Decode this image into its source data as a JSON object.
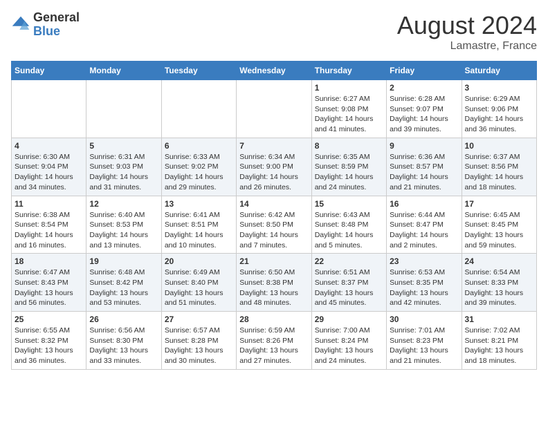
{
  "header": {
    "logo": {
      "general": "General",
      "blue": "Blue"
    },
    "month": "August 2024",
    "location": "Lamastre, France"
  },
  "weekdays": [
    "Sunday",
    "Monday",
    "Tuesday",
    "Wednesday",
    "Thursday",
    "Friday",
    "Saturday"
  ],
  "weeks": [
    [
      {
        "day": "",
        "info": ""
      },
      {
        "day": "",
        "info": ""
      },
      {
        "day": "",
        "info": ""
      },
      {
        "day": "",
        "info": ""
      },
      {
        "day": "1",
        "info": "Sunrise: 6:27 AM\nSunset: 9:08 PM\nDaylight: 14 hours\nand 41 minutes."
      },
      {
        "day": "2",
        "info": "Sunrise: 6:28 AM\nSunset: 9:07 PM\nDaylight: 14 hours\nand 39 minutes."
      },
      {
        "day": "3",
        "info": "Sunrise: 6:29 AM\nSunset: 9:06 PM\nDaylight: 14 hours\nand 36 minutes."
      }
    ],
    [
      {
        "day": "4",
        "info": "Sunrise: 6:30 AM\nSunset: 9:04 PM\nDaylight: 14 hours\nand 34 minutes."
      },
      {
        "day": "5",
        "info": "Sunrise: 6:31 AM\nSunset: 9:03 PM\nDaylight: 14 hours\nand 31 minutes."
      },
      {
        "day": "6",
        "info": "Sunrise: 6:33 AM\nSunset: 9:02 PM\nDaylight: 14 hours\nand 29 minutes."
      },
      {
        "day": "7",
        "info": "Sunrise: 6:34 AM\nSunset: 9:00 PM\nDaylight: 14 hours\nand 26 minutes."
      },
      {
        "day": "8",
        "info": "Sunrise: 6:35 AM\nSunset: 8:59 PM\nDaylight: 14 hours\nand 24 minutes."
      },
      {
        "day": "9",
        "info": "Sunrise: 6:36 AM\nSunset: 8:57 PM\nDaylight: 14 hours\nand 21 minutes."
      },
      {
        "day": "10",
        "info": "Sunrise: 6:37 AM\nSunset: 8:56 PM\nDaylight: 14 hours\nand 18 minutes."
      }
    ],
    [
      {
        "day": "11",
        "info": "Sunrise: 6:38 AM\nSunset: 8:54 PM\nDaylight: 14 hours\nand 16 minutes."
      },
      {
        "day": "12",
        "info": "Sunrise: 6:40 AM\nSunset: 8:53 PM\nDaylight: 14 hours\nand 13 minutes."
      },
      {
        "day": "13",
        "info": "Sunrise: 6:41 AM\nSunset: 8:51 PM\nDaylight: 14 hours\nand 10 minutes."
      },
      {
        "day": "14",
        "info": "Sunrise: 6:42 AM\nSunset: 8:50 PM\nDaylight: 14 hours\nand 7 minutes."
      },
      {
        "day": "15",
        "info": "Sunrise: 6:43 AM\nSunset: 8:48 PM\nDaylight: 14 hours\nand 5 minutes."
      },
      {
        "day": "16",
        "info": "Sunrise: 6:44 AM\nSunset: 8:47 PM\nDaylight: 14 hours\nand 2 minutes."
      },
      {
        "day": "17",
        "info": "Sunrise: 6:45 AM\nSunset: 8:45 PM\nDaylight: 13 hours\nand 59 minutes."
      }
    ],
    [
      {
        "day": "18",
        "info": "Sunrise: 6:47 AM\nSunset: 8:43 PM\nDaylight: 13 hours\nand 56 minutes."
      },
      {
        "day": "19",
        "info": "Sunrise: 6:48 AM\nSunset: 8:42 PM\nDaylight: 13 hours\nand 53 minutes."
      },
      {
        "day": "20",
        "info": "Sunrise: 6:49 AM\nSunset: 8:40 PM\nDaylight: 13 hours\nand 51 minutes."
      },
      {
        "day": "21",
        "info": "Sunrise: 6:50 AM\nSunset: 8:38 PM\nDaylight: 13 hours\nand 48 minutes."
      },
      {
        "day": "22",
        "info": "Sunrise: 6:51 AM\nSunset: 8:37 PM\nDaylight: 13 hours\nand 45 minutes."
      },
      {
        "day": "23",
        "info": "Sunrise: 6:53 AM\nSunset: 8:35 PM\nDaylight: 13 hours\nand 42 minutes."
      },
      {
        "day": "24",
        "info": "Sunrise: 6:54 AM\nSunset: 8:33 PM\nDaylight: 13 hours\nand 39 minutes."
      }
    ],
    [
      {
        "day": "25",
        "info": "Sunrise: 6:55 AM\nSunset: 8:32 PM\nDaylight: 13 hours\nand 36 minutes."
      },
      {
        "day": "26",
        "info": "Sunrise: 6:56 AM\nSunset: 8:30 PM\nDaylight: 13 hours\nand 33 minutes."
      },
      {
        "day": "27",
        "info": "Sunrise: 6:57 AM\nSunset: 8:28 PM\nDaylight: 13 hours\nand 30 minutes."
      },
      {
        "day": "28",
        "info": "Sunrise: 6:59 AM\nSunset: 8:26 PM\nDaylight: 13 hours\nand 27 minutes."
      },
      {
        "day": "29",
        "info": "Sunrise: 7:00 AM\nSunset: 8:24 PM\nDaylight: 13 hours\nand 24 minutes."
      },
      {
        "day": "30",
        "info": "Sunrise: 7:01 AM\nSunset: 8:23 PM\nDaylight: 13 hours\nand 21 minutes."
      },
      {
        "day": "31",
        "info": "Sunrise: 7:02 AM\nSunset: 8:21 PM\nDaylight: 13 hours\nand 18 minutes."
      }
    ]
  ]
}
